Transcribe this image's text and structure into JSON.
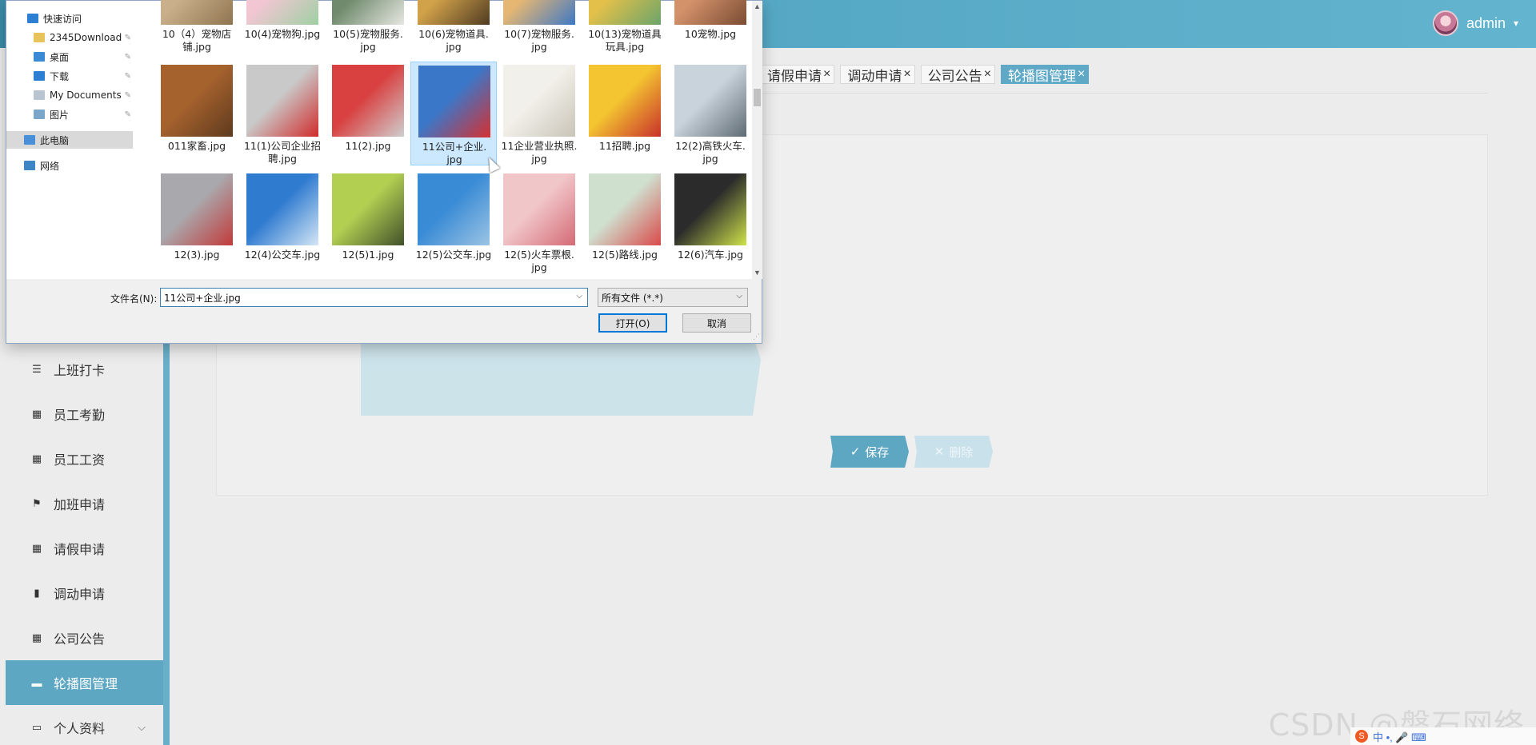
{
  "app": {
    "username": "admin",
    "tab_stub_close": "×",
    "tabs": [
      {
        "label": "请假申请",
        "active": false
      },
      {
        "label": "调动申请",
        "active": false
      },
      {
        "label": "公司公告",
        "active": false
      },
      {
        "label": "轮播图管理",
        "active": true
      }
    ],
    "tab_close_glyph": "×",
    "save_label": "保存",
    "save_icon": "✓",
    "delete_label": "删除",
    "delete_icon": "✕",
    "sidebar": [
      {
        "label": "上班打卡",
        "icon": "list-icon",
        "glyph": "☰",
        "active": false
      },
      {
        "label": "员工考勤",
        "icon": "grid-icon",
        "glyph": "▦",
        "active": false
      },
      {
        "label": "员工工资",
        "icon": "grid-icon",
        "glyph": "▦",
        "active": false
      },
      {
        "label": "加班申请",
        "icon": "flag-icon",
        "glyph": "⚑",
        "active": false
      },
      {
        "label": "请假申请",
        "icon": "grid-icon",
        "glyph": "▦",
        "active": false
      },
      {
        "label": "调动申请",
        "icon": "bar-chart-icon",
        "glyph": "▮",
        "active": false
      },
      {
        "label": "公司公告",
        "icon": "grid-icon",
        "glyph": "▦",
        "active": false
      },
      {
        "label": "轮播图管理",
        "icon": "ticket-icon",
        "glyph": "▬",
        "active": true
      },
      {
        "label": "个人资料",
        "icon": "card-icon",
        "glyph": "▭",
        "active": false
      }
    ],
    "watermark": "CSDN @磐石网络",
    "tray_logo": "S",
    "tray_text": "中 •, 🎤 ⌨"
  },
  "dialog": {
    "nav": [
      {
        "label": "快速访问",
        "icon": "star-icon",
        "color": "#2d7fd3"
      },
      {
        "label": "2345Download",
        "icon": "folder-icon",
        "color": "#e8c25a"
      },
      {
        "label": "桌面",
        "icon": "desktop-icon",
        "color": "#3b8ad6"
      },
      {
        "label": "下载",
        "icon": "download-icon",
        "color": "#2d7fd3"
      },
      {
        "label": "My Documents",
        "icon": "document-icon",
        "color": "#b8c4cf"
      },
      {
        "label": "图片",
        "icon": "pictures-icon",
        "color": "#7aa6c9"
      },
      {
        "label": "此电脑",
        "icon": "computer-icon",
        "color": "#4a90d9"
      },
      {
        "label": "网络",
        "icon": "network-icon",
        "color": "#3d86c6"
      }
    ],
    "pin_glyph": "📌",
    "files": [
      {
        "name": "10（4）宠物店\n铺.jpg",
        "colors": [
          "#c9b08a",
          "#8f7450"
        ]
      },
      {
        "name": "10(4)宠物狗.jpg",
        "colors": [
          "#f2c6d3",
          "#9fd0a3"
        ]
      },
      {
        "name": "10(5)宠物服务.\njpg",
        "colors": [
          "#6f8a6c",
          "#e7e7e2"
        ]
      },
      {
        "name": "10(6)宠物道具.\njpg",
        "colors": [
          "#d2a24a",
          "#4f3b22"
        ]
      },
      {
        "name": "10(7)宠物服务.\njpg",
        "colors": [
          "#e6b773",
          "#3d78c5"
        ]
      },
      {
        "name": "10(13)宠物道具\n玩具.jpg",
        "colors": [
          "#e3c04a",
          "#6aa46a"
        ]
      },
      {
        "name": "10宠物.jpg",
        "colors": [
          "#d4926b",
          "#7a4c33"
        ]
      },
      {
        "name": "011家畜.jpg",
        "colors": [
          "#a5622d",
          "#5e3a1e"
        ]
      },
      {
        "name": "11(1)公司企业招\n聘.jpg",
        "colors": [
          "#c9c9c9",
          "#d12b2b"
        ]
      },
      {
        "name": "11(2).jpg",
        "colors": [
          "#d94040",
          "#cfcfcf"
        ]
      },
      {
        "name": "11公司+企业.\njpg",
        "colors": [
          "#3b77c9",
          "#d63030"
        ]
      },
      {
        "name": "11企业营业执照.\njpg",
        "colors": [
          "#f2f0ea",
          "#c9c4b8"
        ]
      },
      {
        "name": "11招聘.jpg",
        "colors": [
          "#f4c531",
          "#c8302a"
        ]
      },
      {
        "name": "12(2)高铁火车.\njpg",
        "colors": [
          "#c9d3dc",
          "#5f6b73"
        ]
      },
      {
        "name": "12(3).jpg",
        "colors": [
          "#a9a9ad",
          "#c23a3a"
        ]
      },
      {
        "name": "12(4)公交车.jpg",
        "colors": [
          "#2f7bd0",
          "#d5e6f5"
        ]
      },
      {
        "name": "12(5)1.jpg",
        "colors": [
          "#b3cf52",
          "#40502a"
        ]
      },
      {
        "name": "12(5)公交车.jpg",
        "colors": [
          "#3a8bd6",
          "#9cc4e4"
        ]
      },
      {
        "name": "12(5)火车票根.\njpg",
        "colors": [
          "#f1c6c9",
          "#d46a75"
        ]
      },
      {
        "name": "12(5)路线.jpg",
        "colors": [
          "#cfe0cf",
          "#d94a4a"
        ]
      },
      {
        "name": "12(6)汽车.jpg",
        "colors": [
          "#2b2b2b",
          "#cfe34a"
        ]
      }
    ],
    "filename_label": "文件名(N):",
    "filename_value": "11公司+企业.jpg",
    "filetype_value": "所有文件 (*.*)",
    "open_label": "打开(O)",
    "cancel_label": "取消",
    "scroll_up": "▲",
    "scroll_down": "▼",
    "dropdown_glyph": "⌵"
  }
}
